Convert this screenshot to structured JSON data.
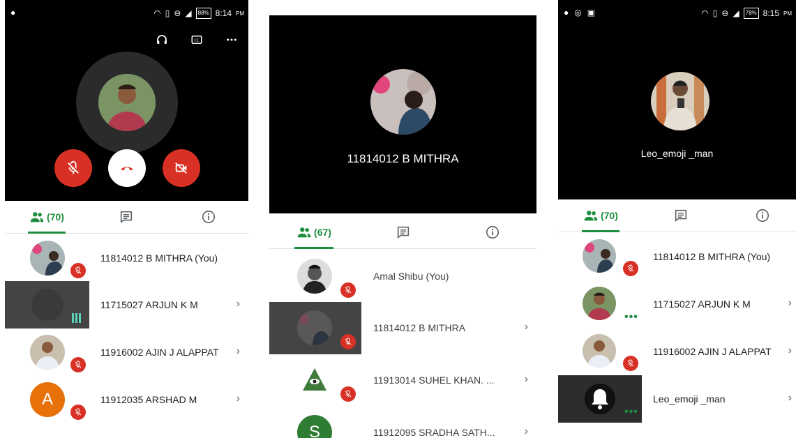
{
  "screen1": {
    "status_time": "8:14",
    "status_ampm": "PM",
    "battery": "88%",
    "people_count": "(70)",
    "participants": [
      {
        "name": "11814012 B MITHRA (You)",
        "muted": true
      },
      {
        "name": "11715027 ARJUN K M",
        "muted": false,
        "speaking": true
      },
      {
        "name": "11916002 AJIN J ALAPPAT",
        "muted": true
      },
      {
        "name": "11912035 ARSHAD M",
        "muted": true,
        "initial": "A"
      }
    ]
  },
  "screen2": {
    "caller_name": "11814012 B MITHRA",
    "people_count": "(67)",
    "participants": [
      {
        "name": "Amal Shibu (You)",
        "muted": true
      },
      {
        "name": "11814012 B MITHRA",
        "muted": true
      },
      {
        "name": "11913014 SUHEL KHAN. ...",
        "muted": true
      },
      {
        "name": "11912095 SRADHA SATH...",
        "muted": true,
        "initial": "S"
      }
    ]
  },
  "screen3": {
    "status_time": "8:15",
    "status_ampm": "PM",
    "battery": "78%",
    "caller_name": "Leo_emoji _man",
    "people_count": "(70)",
    "participants": [
      {
        "name": "11814012 B MITHRA (You)",
        "muted": true
      },
      {
        "name": "11715027 ARJUN K M",
        "muted": false
      },
      {
        "name": "11916002 AJIN J ALAPPAT",
        "muted": true
      },
      {
        "name": "Leo_emoji _man",
        "muted": false
      }
    ]
  },
  "icons": {
    "people": "people-icon",
    "chat": "chat-icon",
    "info": "info-icon",
    "mute": "mic-off-icon",
    "hangup": "call-end-icon",
    "video_off": "videocam-off-icon"
  },
  "colors": {
    "accent_green": "#1e8e3e",
    "mute_red": "#d93025",
    "speaking_teal": "#5ad1b9",
    "avatar_orange": "#e8710a",
    "avatar_green": "#2e7d32"
  }
}
